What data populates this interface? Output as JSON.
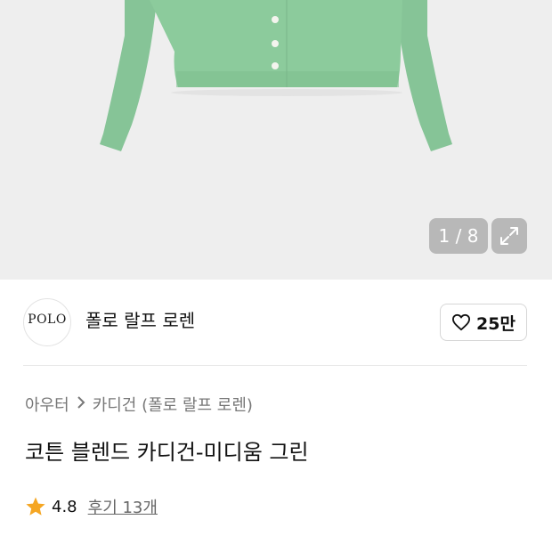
{
  "gallery": {
    "counter": "1 / 8",
    "expand_icon": "expand-icon",
    "product_color": "#8cc89b"
  },
  "brand": {
    "logo_text": "POLO",
    "name": "폴로 랄프 로렌",
    "like_icon": "heart-icon",
    "like_count": "25만"
  },
  "breadcrumb": {
    "category": "아우터",
    "separator_icon": "chevron-right-icon",
    "subcategory": "카디건 (폴로 랄프 로렌)"
  },
  "product": {
    "title": "코튼 블렌드 카디건-미디움 그린"
  },
  "rating": {
    "star_icon": "star-icon",
    "star_color": "#f5a623",
    "score": "4.8",
    "reviews": "후기 13개"
  }
}
